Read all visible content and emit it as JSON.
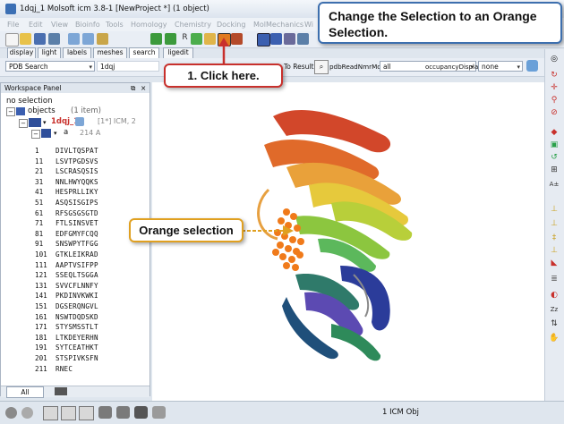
{
  "window": {
    "title": "1dqj_1 Molsoft icm 3.8-1  [NewProject *] (1 object)"
  },
  "menu": [
    "File",
    "Edit",
    "View",
    "Bioinfo",
    "Tools",
    "Homology",
    "Chemistry",
    "Docking",
    "MolMechanics",
    "Wi"
  ],
  "tabs": [
    "display",
    "light",
    "labels",
    "meshes",
    "search",
    "ligedit"
  ],
  "active_tab": "search",
  "search_bar": {
    "db": "PDB Search",
    "query": "1dqj",
    "to_result": "To Result",
    "pdb_read": "pdbReadNmrMod",
    "all_value": "all",
    "occupancy": "occupancyDispla",
    "none_value": "none"
  },
  "workspace": {
    "title": "Workspace Panel",
    "no_selection": "no selection",
    "objects_label": "objects",
    "objects_count": "(1 item)",
    "object_name": "1dqj_1",
    "object_info": "[1*] ICM, 2",
    "chain": "a",
    "chain_len": "214 A",
    "seq_rows": [
      {
        "n": "1",
        "s": "DIVLTQSPAT"
      },
      {
        "n": "11",
        "s": "LSVTPGDSVS"
      },
      {
        "n": "21",
        "s": "LSCRASQSIS"
      },
      {
        "n": "31",
        "s": "NNLHWYQQKS"
      },
      {
        "n": "41",
        "s": "HESPRLLIKY"
      },
      {
        "n": "51",
        "s": "ASQSISGIPS"
      },
      {
        "n": "61",
        "s": "RFSGSGSGTD"
      },
      {
        "n": "71",
        "s": "FTLSINSVET"
      },
      {
        "n": "81",
        "s": "EDFGMYFCQQ"
      },
      {
        "n": "91",
        "s": "SNSWPYTFGG"
      },
      {
        "n": "101",
        "s": "GTKLEIKRAD"
      },
      {
        "n": "111",
        "s": "AAPTVSIFPP"
      },
      {
        "n": "121",
        "s": "SSEQLTSGGA"
      },
      {
        "n": "131",
        "s": "SVVCFLNNFY"
      },
      {
        "n": "141",
        "s": "PKDINVKWKI"
      },
      {
        "n": "151",
        "s": "DGSERQNGVL"
      },
      {
        "n": "161",
        "s": "NSWTDQDSKD"
      },
      {
        "n": "171",
        "s": "STYSMSSTLT"
      },
      {
        "n": "181",
        "s": "LTKDEYERHN"
      },
      {
        "n": "191",
        "s": "SYTCEATHKT"
      },
      {
        "n": "201",
        "s": "STSPIVKSFN"
      },
      {
        "n": "211",
        "s": "RNEC"
      }
    ],
    "bottom_tabs": [
      "All"
    ]
  },
  "status": {
    "objects": "1 ICM Obj"
  },
  "callouts": {
    "step1": "1. Click here.",
    "instruction": "Change the Selection to an Orange Selection.",
    "orange": "Orange selection"
  },
  "colors": {
    "accent_red": "#c8302c",
    "accent_blue": "#3d6fae",
    "orange": "#f07a1a"
  }
}
